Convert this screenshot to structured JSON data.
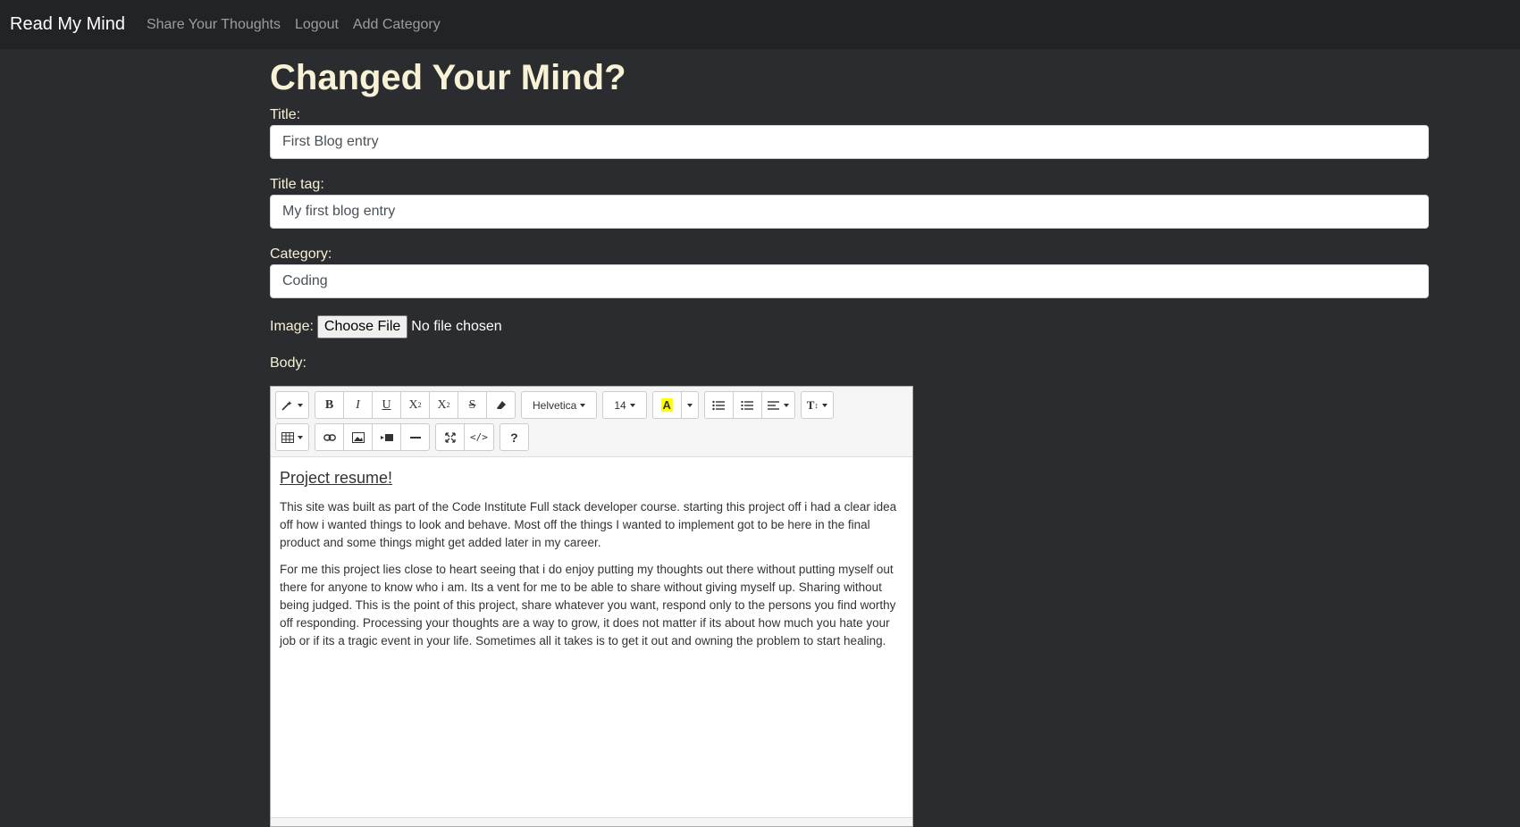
{
  "navbar": {
    "brand": "Read My Mind",
    "links": [
      "Share Your Thoughts",
      "Logout",
      "Add Category"
    ]
  },
  "page_title": "Changed Your Mind?",
  "form": {
    "title_label": "Title:",
    "title_value": "First Blog entry",
    "title_tag_label": "Title tag:",
    "title_tag_value": "My first blog entry",
    "category_label": "Category:",
    "category_value": "Coding",
    "image_label": "Image:",
    "choose_file_label": "Choose File",
    "no_file_text": "No file chosen",
    "body_label": "Body:"
  },
  "editor": {
    "font_name": "Helvetica",
    "font_size": "14",
    "highlight_letter": "A",
    "toolbar_icons": [
      "magic-icon",
      "bold-icon",
      "italic-icon",
      "underline-icon",
      "superscript-icon",
      "subscript-icon",
      "strikethrough-icon",
      "eraser-icon",
      "font-name-dropdown",
      "font-size-dropdown",
      "highlight-color-icon",
      "unordered-list-icon",
      "ordered-list-icon",
      "align-icon",
      "line-height-icon",
      "table-icon",
      "link-icon",
      "picture-icon",
      "video-icon",
      "horizontal-rule-icon",
      "fullscreen-icon",
      "code-view-icon",
      "help-icon"
    ],
    "heading": "Project resume!",
    "paragraphs": [
      "This site was built as part of the Code Institute Full stack developer course. starting this project off i had a clear idea off how i wanted things to look and behave. Most off the things I wanted to implement got to be here in the final product and some things might get added later in my career.",
      "For me this project lies close to heart seeing that i do enjoy putting my thoughts out there without putting myself out there for anyone to know who i am. Its a vent for me to be able to share without giving myself up. Sharing without being judged. This is the point of this project, share whatever you want, respond only to the persons you find worthy off responding. Processing your thoughts are a way to grow, it does not matter if its about how much you hate your job or if its a tragic event in your life. Sometimes all it takes is to get it out and owning the problem to start healing."
    ]
  }
}
